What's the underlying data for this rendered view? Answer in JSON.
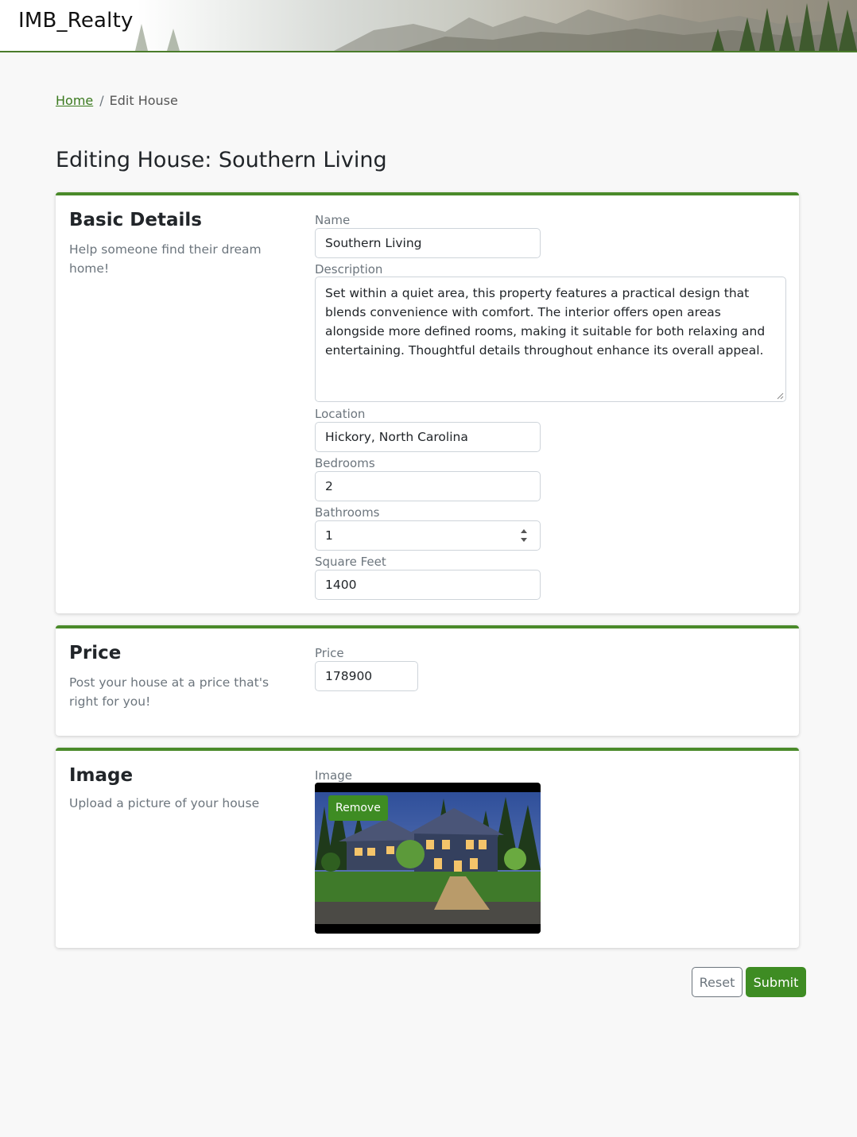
{
  "header": {
    "brand": "IMB_Realty"
  },
  "breadcrumb": {
    "home": "Home",
    "separator": "/",
    "current": "Edit House"
  },
  "page": {
    "title": "Editing House: Southern Living"
  },
  "basic_details": {
    "title": "Basic Details",
    "description": "Help someone find their dream home!",
    "fields": {
      "name": {
        "label": "Name",
        "value": "Southern Living"
      },
      "description": {
        "label": "Description",
        "value": "Set within a quiet area, this property features a practical design that blends convenience with comfort. The interior offers open areas alongside more defined rooms, making it suitable for both relaxing and entertaining. Thoughtful details throughout enhance its overall appeal."
      },
      "location": {
        "label": "Location",
        "value": "Hickory, North Carolina"
      },
      "bedrooms": {
        "label": "Bedrooms",
        "value": "2"
      },
      "bathrooms": {
        "label": "Bathrooms",
        "value": "1"
      },
      "square_feet": {
        "label": "Square Feet",
        "value": "1400"
      }
    }
  },
  "price": {
    "title": "Price",
    "description": "Post your house at a price that's right for you!",
    "field": {
      "label": "Price",
      "value": "178900"
    }
  },
  "image": {
    "title": "Image",
    "description": "Upload a picture of your house",
    "field": {
      "label": "Image"
    },
    "remove_label": "Remove"
  },
  "actions": {
    "reset_label": "Reset",
    "submit_label": "Submit"
  },
  "colors": {
    "accent": "#3e8c23",
    "card_border": "#4a8a2a",
    "muted_text": "#6c757d"
  }
}
